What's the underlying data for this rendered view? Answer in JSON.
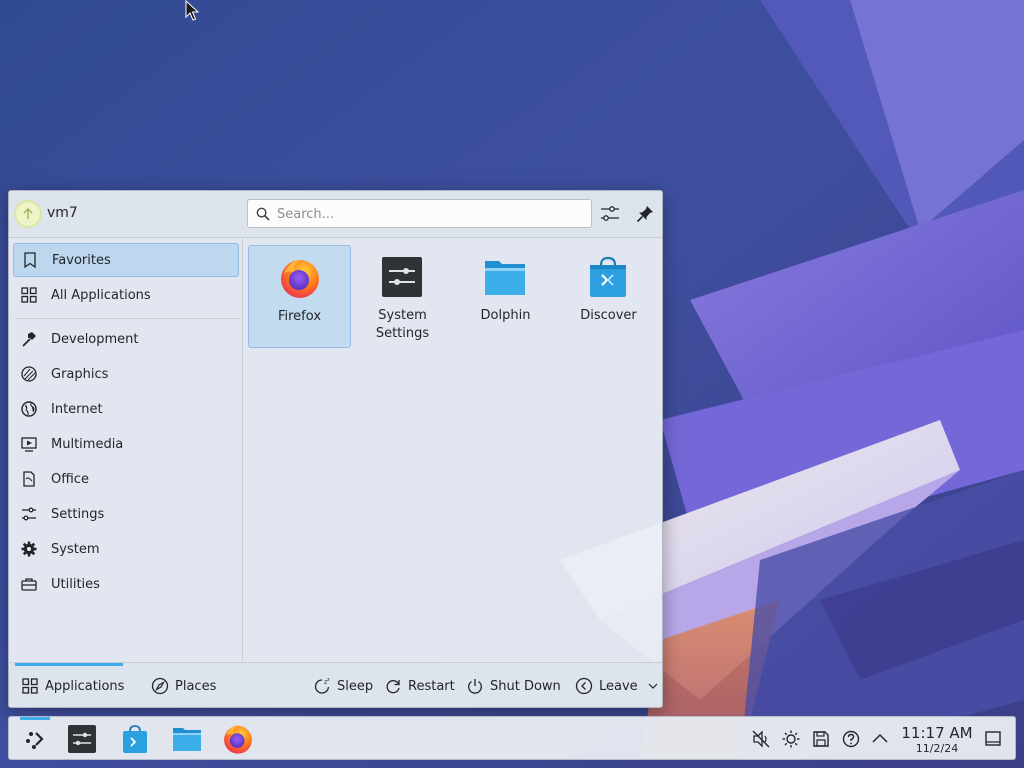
{
  "launcher": {
    "username": "vm7",
    "search": {
      "placeholder": "Search..."
    },
    "sidebar": {
      "items": [
        {
          "label": "Favorites",
          "icon": "bookmark-icon",
          "selected": true
        },
        {
          "label": "All Applications",
          "icon": "grid-icon"
        },
        {
          "label": "Development",
          "icon": "hammer-icon"
        },
        {
          "label": "Graphics",
          "icon": "palette-icon"
        },
        {
          "label": "Internet",
          "icon": "globe-icon"
        },
        {
          "label": "Multimedia",
          "icon": "media-icon"
        },
        {
          "label": "Office",
          "icon": "document-icon"
        },
        {
          "label": "Settings",
          "icon": "sliders-icon"
        },
        {
          "label": "System",
          "icon": "gear-icon"
        },
        {
          "label": "Utilities",
          "icon": "toolbox-icon"
        }
      ]
    },
    "favorites": [
      {
        "label": "Firefox",
        "icon": "firefox-icon",
        "selected": true
      },
      {
        "label": "System Settings",
        "icon": "system-settings-icon"
      },
      {
        "label": "Dolphin",
        "icon": "folder-icon"
      },
      {
        "label": "Discover",
        "icon": "discover-bag-icon"
      }
    ],
    "footer": {
      "tabs": [
        {
          "label": "Applications",
          "icon": "grid-icon",
          "active": true
        },
        {
          "label": "Places",
          "icon": "compass-icon"
        }
      ],
      "actions": [
        {
          "label": "Sleep",
          "icon": "sleep-icon"
        },
        {
          "label": "Restart",
          "icon": "restart-icon"
        },
        {
          "label": "Shut Down",
          "icon": "power-icon"
        },
        {
          "label": "Leave",
          "icon": "leave-icon"
        }
      ]
    }
  },
  "taskbar": {
    "pinned": [
      {
        "name": "Application Launcher",
        "icon": "kde-launcher-icon"
      },
      {
        "name": "System Settings",
        "icon": "system-settings-icon"
      },
      {
        "name": "Discover",
        "icon": "discover-bag-icon"
      },
      {
        "name": "Dolphin",
        "icon": "folder-icon"
      },
      {
        "name": "Firefox",
        "icon": "firefox-icon"
      }
    ],
    "tray": {
      "icons": [
        "muted-speaker-icon",
        "brightness-icon",
        "save-disk-icon",
        "help-circle-icon",
        "chevron-up-icon"
      ],
      "time": "11:17 AM",
      "date": "11/2/24"
    }
  },
  "colors": {
    "accent": "#3daee9",
    "selection": "#bdd7ee"
  }
}
